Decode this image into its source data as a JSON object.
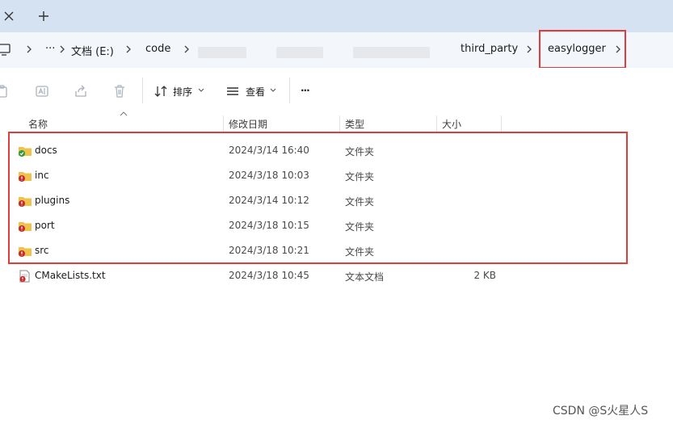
{
  "breadcrumb": {
    "more": "···",
    "drive": "文档 (E:)",
    "folder1": "code",
    "folder2": "third_party",
    "current": "easylogger"
  },
  "toolbar": {
    "sort_label": "排序",
    "view_label": "查看",
    "more_label": "···"
  },
  "columns": {
    "name": "名称",
    "modified": "修改日期",
    "type": "类型",
    "size": "大小"
  },
  "files": [
    {
      "name": "docs",
      "date": "2024/3/14 16:40",
      "type": "文件夹",
      "size": "",
      "status": "synced"
    },
    {
      "name": "inc",
      "date": "2024/3/18 10:03",
      "type": "文件夹",
      "size": "",
      "status": "error"
    },
    {
      "name": "plugins",
      "date": "2024/3/14 10:12",
      "type": "文件夹",
      "size": "",
      "status": "error"
    },
    {
      "name": "port",
      "date": "2024/3/18 10:15",
      "type": "文件夹",
      "size": "",
      "status": "error"
    },
    {
      "name": "src",
      "date": "2024/3/18 10:21",
      "type": "文件夹",
      "size": "",
      "status": "error"
    },
    {
      "name": "CMakeLists.txt",
      "date": "2024/3/18 10:45",
      "type": "文本文档",
      "size": "2 KB",
      "status": "error"
    }
  ],
  "watermark": "CSDN @S火星人S",
  "colors": {
    "tabstrip": "#d4e2f2",
    "addrbar": "#f3f6fb",
    "highlight": "#e03c3c",
    "folder": "#f0c14b",
    "status_ok": "#2e9b3e",
    "status_error": "#c92a2a"
  }
}
